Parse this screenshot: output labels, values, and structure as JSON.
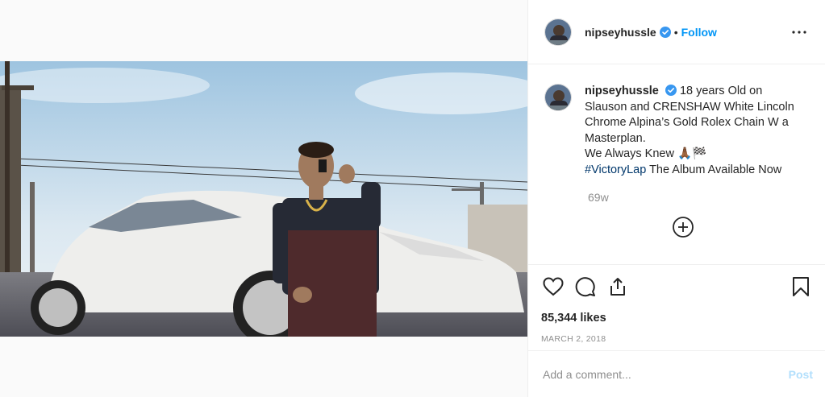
{
  "post": {
    "username": "nipseyhussle",
    "follow_label": "Follow",
    "dot": "•",
    "caption_lines": [
      "18 years Old on",
      "Slauson and CRENSHAW White Lincoln",
      "Chrome Alpina’s Gold Rolex Chain W a",
      "Masterplan."
    ],
    "caption_line5": "We Always Knew 🙏🏾🏁",
    "hashtag": "#VictoryLap",
    "hashtag_rest": " The Album Available Now",
    "time_ago": "69w",
    "likes": "85,344 likes",
    "date": "March 2, 2018"
  },
  "comment": {
    "placeholder": "Add a comment...",
    "post_label": "Post"
  },
  "icons": {
    "verified": "verified-badge-icon",
    "more": "more-options-icon",
    "load_more": "plus-circle-icon",
    "like": "heart-icon",
    "comment": "comment-bubble-icon",
    "share": "share-icon",
    "save": "bookmark-icon"
  },
  "colors": {
    "link": "#0095f6",
    "hashtag": "#00376b",
    "muted": "#8e8e8e",
    "post_disabled": "#b2dffc"
  }
}
